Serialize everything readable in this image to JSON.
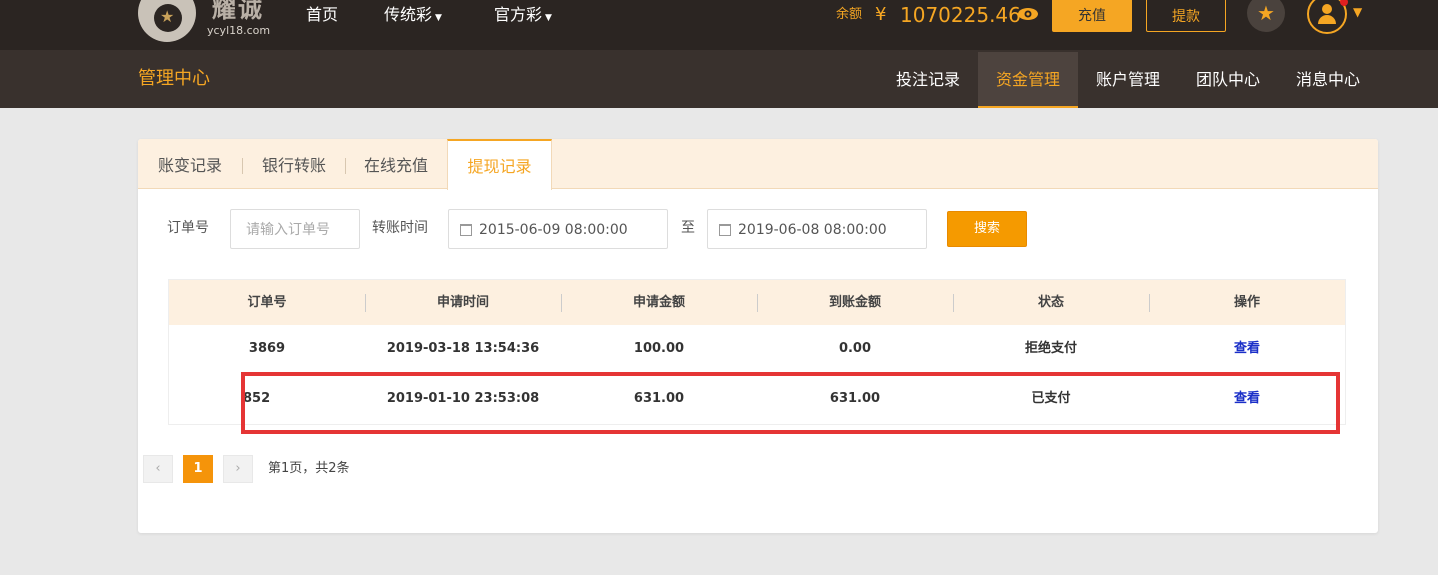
{
  "header": {
    "logo_text": "耀诚",
    "logo_domain": "ycyl18.com",
    "nav": {
      "home": "首页",
      "traditional": "传统彩",
      "official": "官方彩"
    },
    "balance_label": "余额",
    "currency_symbol": "¥",
    "balance_value": "1070225.46",
    "recharge_label": "充值",
    "withdraw_label": "提款"
  },
  "subnav": {
    "title": "管理中心",
    "items": [
      "投注记录",
      "资金管理",
      "账户管理",
      "团队中心",
      "消息中心"
    ],
    "active": "资金管理"
  },
  "tabs": {
    "items": [
      "账变记录",
      "银行转账",
      "在线充值",
      "提现记录"
    ],
    "active": "提现记录"
  },
  "filters": {
    "order_label": "订单号",
    "order_placeholder": "请输入订单号",
    "time_label": "转账时间",
    "start_time": "2015-06-09 08:00:00",
    "to_label": "至",
    "end_time": "2019-06-08 08:00:00",
    "search_label": "搜索"
  },
  "table": {
    "columns": [
      "订单号",
      "申请时间",
      "申请金额",
      "到账金额",
      "状态",
      "操作"
    ],
    "rows": [
      {
        "order_no": "3869",
        "apply_time": "2019-03-18 13:54:36",
        "apply_amount": "100.00",
        "received_amount": "0.00",
        "status": "拒绝支付",
        "action": "查看"
      },
      {
        "order_no": "852",
        "apply_time": "2019-01-10 23:53:08",
        "apply_amount": "631.00",
        "received_amount": "631.00",
        "status": "已支付",
        "action": "查看"
      }
    ]
  },
  "pagination": {
    "prev": "‹",
    "current": "1",
    "next": "›",
    "info": "第1页，共2条"
  },
  "colors": {
    "accent": "#f5a623",
    "topbar": "#2b2522",
    "subbar": "#39312d",
    "highlight": "#e53535",
    "link": "#1a2fc8"
  },
  "icons": [
    "logo-icon",
    "eye-icon",
    "star-icon",
    "user-avatar-icon",
    "calendar-icon",
    "chevron-left-icon",
    "chevron-right-icon"
  ]
}
